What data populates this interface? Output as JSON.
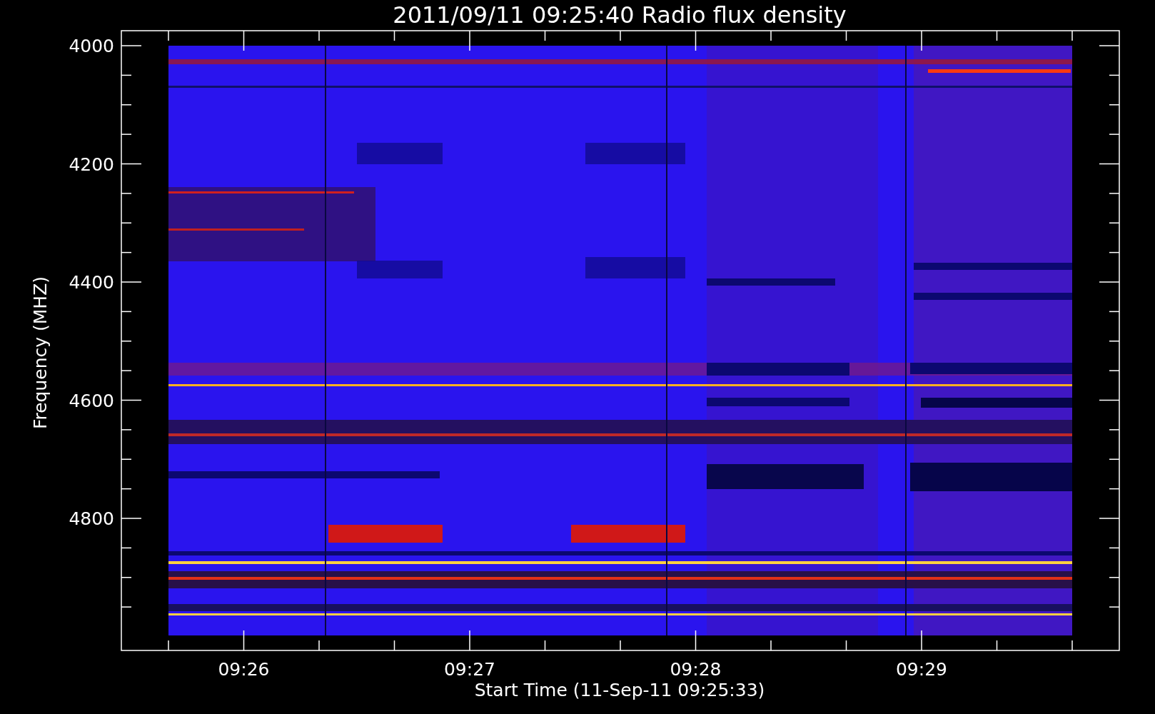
{
  "title": "2011/09/11 09:25:40 Radio flux density",
  "y_axis": {
    "label": "Frequency (MHZ)",
    "ticks": [
      "4000",
      "4200",
      "4400",
      "4600",
      "4800"
    ]
  },
  "x_axis": {
    "label": "Start Time (11-Sep-11 09:25:33)",
    "ticks": [
      "09:26",
      "09:27",
      "09:28",
      "09:29"
    ]
  }
}
